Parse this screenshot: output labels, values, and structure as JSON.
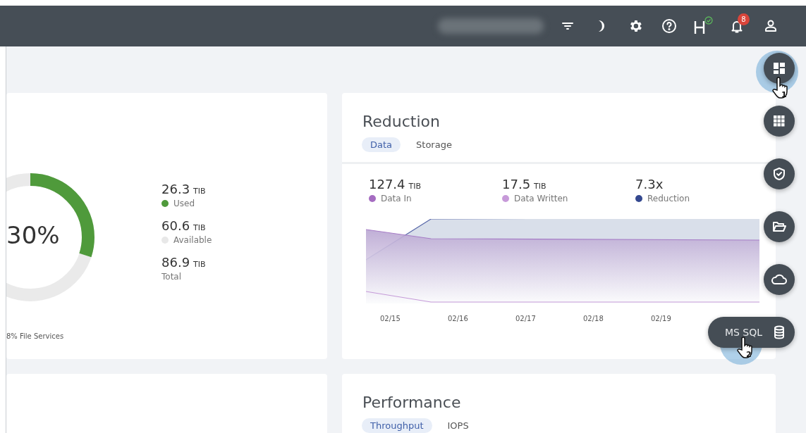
{
  "header": {
    "notification_count": "8",
    "health_ok": true
  },
  "capacity": {
    "percent": "30%",
    "level": 0.3,
    "stats": [
      {
        "value": "26.3",
        "unit": "TIB",
        "label": "Used",
        "color": "#4f9a3b"
      },
      {
        "value": "60.6",
        "unit": "TIB",
        "label": "Available",
        "color": "#e8e8e8"
      },
      {
        "value": "86.9",
        "unit": "TIB",
        "label": "Total"
      }
    ],
    "footnote": "8% File Services"
  },
  "reduction": {
    "title": "Reduction",
    "tabs": [
      {
        "label": "Data",
        "selected": true
      },
      {
        "label": "Storage",
        "selected": false
      }
    ],
    "stats": [
      {
        "value": "127.4",
        "unit": "TIB",
        "label": "Data In",
        "color": "#a56cc1"
      },
      {
        "value": "17.5",
        "unit": "TIB",
        "label": "Data Written",
        "color": "#c79ad9"
      },
      {
        "value": "7.3x",
        "label": "Reduction",
        "color": "#34488f"
      }
    ],
    "axis_labels": [
      "02/15",
      "02/16",
      "02/17",
      "02/18",
      "02/19"
    ]
  },
  "performance": {
    "title": "Performance",
    "tabs": [
      {
        "label": "Throughput",
        "selected": true
      },
      {
        "label": "IOPS",
        "selected": false
      }
    ]
  },
  "dock": [
    {
      "kind": "icon",
      "pressed": true
    },
    {
      "kind": "icon",
      "pressed": false
    },
    {
      "kind": "icon",
      "pressed": false
    },
    {
      "kind": "icon",
      "pressed": false
    },
    {
      "kind": "icon",
      "pressed": false
    },
    {
      "kind": "labeled",
      "label": "MS SQL",
      "pressed": true
    }
  ],
  "cursors": [
    {
      "step": "1"
    },
    {
      "step": "2"
    }
  ]
}
